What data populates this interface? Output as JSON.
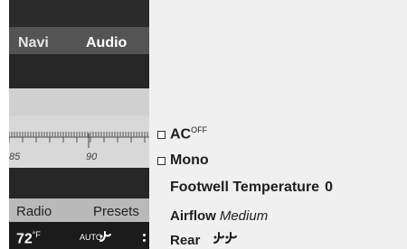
{
  "tabs": {
    "navi": "Navi",
    "audio": "Audio"
  },
  "tuner_scale": {
    "low": "85",
    "high": "90"
  },
  "softkeys": {
    "radio": "Radio",
    "presets": "Presets"
  },
  "status": {
    "temperature": "72",
    "unit": "°F",
    "auto": "AUTO",
    "fan_icon": "fan-airflow-icon"
  },
  "climate_menu": {
    "ac": {
      "label": "AC",
      "state": "OFF",
      "checked": false
    },
    "mono": {
      "label": "Mono",
      "checked": false
    },
    "footwell": {
      "label": "Footwell Temperature",
      "value": "0"
    },
    "airflow": {
      "label": "Airflow",
      "value": "Medium"
    },
    "rear": {
      "label": "Rear",
      "icon": "rear-airflow-icon"
    }
  }
}
